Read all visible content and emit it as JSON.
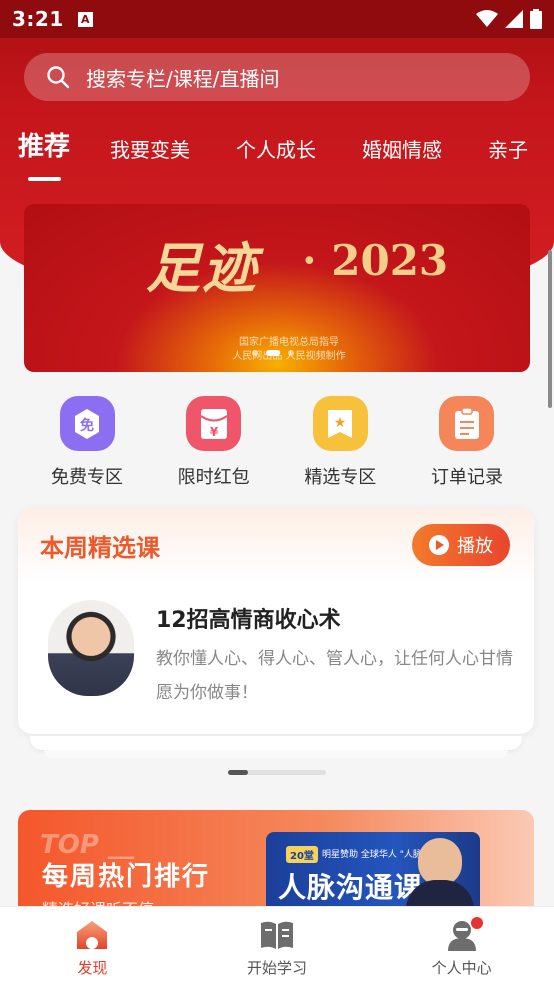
{
  "status_bar": {
    "time": "3:21",
    "sim_label": "A",
    "icons": [
      "wifi-icon",
      "signal-icon",
      "battery-icon"
    ]
  },
  "search": {
    "placeholder": "搜索专栏/课程/直播间"
  },
  "tabs": [
    {
      "label": "推荐",
      "active": true
    },
    {
      "label": "我要变美",
      "active": false
    },
    {
      "label": "个人成长",
      "active": false
    },
    {
      "label": "婚姻情感",
      "active": false
    },
    {
      "label": "亲子",
      "active": false
    }
  ],
  "banner": {
    "title": "足迹",
    "year": "· 2023",
    "line1": "国家广播电视总局指导",
    "line2": "人民网出品 人民视频制作",
    "slide_count": 3,
    "active_slide": 2
  },
  "quick_entries": [
    {
      "label": "免费专区",
      "icon": "free-badge-icon",
      "glyph": "免",
      "color": "#8b6ff0"
    },
    {
      "label": "限时红包",
      "icon": "red-envelope-icon",
      "glyph": "¥",
      "color": "#f0566a"
    },
    {
      "label": "精选专区",
      "icon": "star-badge-icon",
      "glyph": "★",
      "color": "#f7c13b"
    },
    {
      "label": "订单记录",
      "icon": "clipboard-icon",
      "glyph": "",
      "color": "#f4865a"
    }
  ],
  "weekly": {
    "title": "本周精选课",
    "play_label": "播放",
    "course_name": "12招高情商收心术",
    "course_desc": "教你懂人心、得人心、管人心，让任何人心甘情愿为你做事！"
  },
  "ranking": {
    "top_label": "TOP __",
    "title": "每周热门排行",
    "subtitle": "精选好课听不停",
    "poster_badge": "20堂",
    "poster_small": "明星赞助 全球华人 \"人脉王\"",
    "poster_title": "人脉沟通课"
  },
  "bottom_nav": [
    {
      "label": "发现",
      "icon": "house-icon",
      "active": true
    },
    {
      "label": "开始学习",
      "icon": "open-book-icon",
      "active": false
    },
    {
      "label": "个人中心",
      "icon": "user-icon",
      "active": false,
      "badge": true
    }
  ],
  "colors": {
    "brand_red": "#c4161b",
    "accent_orange": "#e95a2c",
    "nav_active": "#e53b2b"
  }
}
